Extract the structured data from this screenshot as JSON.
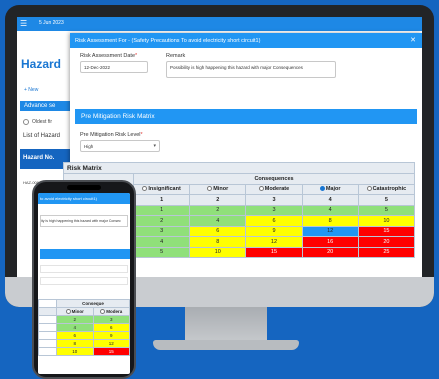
{
  "colors": {
    "background": "#1565c0",
    "accent": "#2196f3",
    "green": "#90e07a",
    "yellow": "#ffff00",
    "orange": "#ff8c1a",
    "red": "#ff0000",
    "blue": "#2196f3"
  },
  "app": {
    "date": "5 Jun 2023",
    "title": "Hazard",
    "new_label": "+ New",
    "advanced_search": "Advance se",
    "radio_label": "Oldest fir",
    "list_label": "List of Hazard",
    "col_hazard_no": "Hazard No.",
    "hazard_id": "HAZ-0000"
  },
  "modal": {
    "title": "Risk Assessment For - (Safety Precautions To avoid electricity short circuit1)",
    "close_icon": "close-icon",
    "date_label": "Risk Assessment Date",
    "date_value": "12-Dec-2022",
    "remark_label": "Remark",
    "remark_value": "Possibility is high happening this hazard with major Consequences",
    "section_title": "Pre Mitigation Risk Matrix",
    "level_label": "Pre Mitigation Risk Level",
    "level_value": "High"
  },
  "matrix": {
    "title": "Risk Matrix",
    "likelihood_label": "Likelihood",
    "consequences_label": "Consequences",
    "consequences": [
      {
        "label": "Insignificant",
        "selected": false
      },
      {
        "label": "Minor",
        "selected": false
      },
      {
        "label": "Moderate",
        "selected": false
      },
      {
        "label": "Major",
        "selected": true
      },
      {
        "label": "Catastrophic",
        "selected": false
      }
    ],
    "column_numbers": [
      "1",
      "2",
      "3",
      "4",
      "5"
    ],
    "rows": [
      [
        {
          "v": "1",
          "c": "green"
        },
        {
          "v": "2",
          "c": "green"
        },
        {
          "v": "3",
          "c": "green"
        },
        {
          "v": "4",
          "c": "green"
        },
        {
          "v": "5",
          "c": "green"
        }
      ],
      [
        {
          "v": "2",
          "c": "green"
        },
        {
          "v": "4",
          "c": "green"
        },
        {
          "v": "6",
          "c": "yellow"
        },
        {
          "v": "8",
          "c": "yellow"
        },
        {
          "v": "10",
          "c": "yellow"
        }
      ],
      [
        {
          "v": "3",
          "c": "green"
        },
        {
          "v": "6",
          "c": "yellow"
        },
        {
          "v": "9",
          "c": "yellow"
        },
        {
          "v": "12",
          "c": "blue"
        },
        {
          "v": "15",
          "c": "red"
        }
      ],
      [
        {
          "v": "4",
          "c": "green"
        },
        {
          "v": "8",
          "c": "yellow"
        },
        {
          "v": "12",
          "c": "yellow"
        },
        {
          "v": "16",
          "c": "red"
        },
        {
          "v": "20",
          "c": "red"
        }
      ],
      [
        {
          "v": "5",
          "c": "green"
        },
        {
          "v": "10",
          "c": "yellow"
        },
        {
          "v": "15",
          "c": "red"
        },
        {
          "v": "20",
          "c": "red"
        },
        {
          "v": "25",
          "c": "red"
        }
      ]
    ]
  },
  "phone": {
    "header": "to avoid electricity short circuit1)",
    "remark_snippet": "ity is high happening this hazard with major Consec",
    "consequences_label": "Conseque",
    "minor_label": "Minor",
    "moderate_label": "Modera",
    "rows": [
      [
        {
          "v": "2",
          "c": "green"
        },
        {
          "v": "3",
          "c": "green"
        }
      ],
      [
        {
          "v": "4",
          "c": "green"
        },
        {
          "v": "6",
          "c": "yellow"
        }
      ],
      [
        {
          "v": "6",
          "c": "yellow"
        },
        {
          "v": "9",
          "c": "yellow"
        }
      ],
      [
        {
          "v": "8",
          "c": "yellow"
        },
        {
          "v": "12",
          "c": "yellow"
        }
      ],
      [
        {
          "v": "10",
          "c": "yellow"
        },
        {
          "v": "15",
          "c": "red"
        }
      ]
    ]
  }
}
